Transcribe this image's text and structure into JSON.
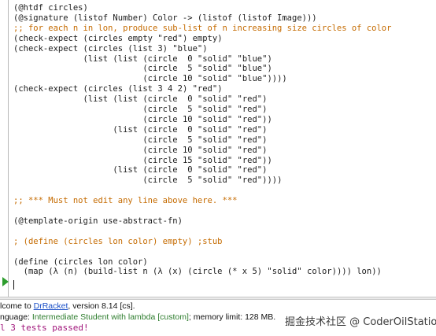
{
  "editor": {
    "lines": [
      [
        {
          "t": "(@htdf circles)",
          "k": "p"
        }
      ],
      [
        {
          "t": "(@signature (listof Number) Color -> (listof (listof Image)))",
          "k": "p"
        }
      ],
      [
        {
          "t": ";; for each n in lon, produce sub-list of n increasing size circles of color",
          "k": "c"
        }
      ],
      [
        {
          "t": "(check-expect (circles empty ",
          "k": "p"
        },
        {
          "t": "\"red\"",
          "k": "str"
        },
        {
          "t": ") empty)",
          "k": "p"
        }
      ],
      [
        {
          "t": "(check-expect (circles (list ",
          "k": "p"
        },
        {
          "t": "3",
          "k": "n"
        },
        {
          "t": ") ",
          "k": "p"
        },
        {
          "t": "\"blue\"",
          "k": "str"
        },
        {
          "t": ")",
          "k": "p"
        }
      ],
      [
        {
          "t": "              (list (list (circle  ",
          "k": "p"
        },
        {
          "t": "0",
          "k": "n"
        },
        {
          "t": " ",
          "k": "p"
        },
        {
          "t": "\"solid\"",
          "k": "str"
        },
        {
          "t": " ",
          "k": "p"
        },
        {
          "t": "\"blue\"",
          "k": "str"
        },
        {
          "t": ")",
          "k": "p"
        }
      ],
      [
        {
          "t": "                          (circle  ",
          "k": "p"
        },
        {
          "t": "5",
          "k": "n"
        },
        {
          "t": " ",
          "k": "p"
        },
        {
          "t": "\"solid\"",
          "k": "str"
        },
        {
          "t": " ",
          "k": "p"
        },
        {
          "t": "\"blue\"",
          "k": "str"
        },
        {
          "t": ")",
          "k": "p"
        }
      ],
      [
        {
          "t": "                          (circle ",
          "k": "p"
        },
        {
          "t": "10",
          "k": "n"
        },
        {
          "t": " ",
          "k": "p"
        },
        {
          "t": "\"solid\"",
          "k": "str"
        },
        {
          "t": " ",
          "k": "p"
        },
        {
          "t": "\"blue\"",
          "k": "str"
        },
        {
          "t": "))))",
          "k": "p"
        }
      ],
      [
        {
          "t": "(check-expect (circles (list ",
          "k": "p"
        },
        {
          "t": "3 4 2",
          "k": "n"
        },
        {
          "t": ") ",
          "k": "p"
        },
        {
          "t": "\"red\"",
          "k": "str"
        },
        {
          "t": ")",
          "k": "p"
        }
      ],
      [
        {
          "t": "              (list (list (circle  ",
          "k": "p"
        },
        {
          "t": "0",
          "k": "n"
        },
        {
          "t": " ",
          "k": "p"
        },
        {
          "t": "\"solid\"",
          "k": "str"
        },
        {
          "t": " ",
          "k": "p"
        },
        {
          "t": "\"red\"",
          "k": "str"
        },
        {
          "t": ")",
          "k": "p"
        }
      ],
      [
        {
          "t": "                          (circle  ",
          "k": "p"
        },
        {
          "t": "5",
          "k": "n"
        },
        {
          "t": " ",
          "k": "p"
        },
        {
          "t": "\"solid\"",
          "k": "str"
        },
        {
          "t": " ",
          "k": "p"
        },
        {
          "t": "\"red\"",
          "k": "str"
        },
        {
          "t": ")",
          "k": "p"
        }
      ],
      [
        {
          "t": "                          (circle ",
          "k": "p"
        },
        {
          "t": "10",
          "k": "n"
        },
        {
          "t": " ",
          "k": "p"
        },
        {
          "t": "\"solid\"",
          "k": "str"
        },
        {
          "t": " ",
          "k": "p"
        },
        {
          "t": "\"red\"",
          "k": "str"
        },
        {
          "t": "))",
          "k": "p"
        }
      ],
      [
        {
          "t": "                    (list (circle  ",
          "k": "p"
        },
        {
          "t": "0",
          "k": "n"
        },
        {
          "t": " ",
          "k": "p"
        },
        {
          "t": "\"solid\"",
          "k": "str"
        },
        {
          "t": " ",
          "k": "p"
        },
        {
          "t": "\"red\"",
          "k": "str"
        },
        {
          "t": ")",
          "k": "p"
        }
      ],
      [
        {
          "t": "                          (circle  ",
          "k": "p"
        },
        {
          "t": "5",
          "k": "n"
        },
        {
          "t": " ",
          "k": "p"
        },
        {
          "t": "\"solid\"",
          "k": "str"
        },
        {
          "t": " ",
          "k": "p"
        },
        {
          "t": "\"red\"",
          "k": "str"
        },
        {
          "t": ")",
          "k": "p"
        }
      ],
      [
        {
          "t": "                          (circle ",
          "k": "p"
        },
        {
          "t": "10",
          "k": "n"
        },
        {
          "t": " ",
          "k": "p"
        },
        {
          "t": "\"solid\"",
          "k": "str"
        },
        {
          "t": " ",
          "k": "p"
        },
        {
          "t": "\"red\"",
          "k": "str"
        },
        {
          "t": ")",
          "k": "p"
        }
      ],
      [
        {
          "t": "                          (circle ",
          "k": "p"
        },
        {
          "t": "15",
          "k": "n"
        },
        {
          "t": " ",
          "k": "p"
        },
        {
          "t": "\"solid\"",
          "k": "str"
        },
        {
          "t": " ",
          "k": "p"
        },
        {
          "t": "\"red\"",
          "k": "str"
        },
        {
          "t": "))",
          "k": "p"
        }
      ],
      [
        {
          "t": "                    (list (circle  ",
          "k": "p"
        },
        {
          "t": "0",
          "k": "n"
        },
        {
          "t": " ",
          "k": "p"
        },
        {
          "t": "\"solid\"",
          "k": "str"
        },
        {
          "t": " ",
          "k": "p"
        },
        {
          "t": "\"red\"",
          "k": "str"
        },
        {
          "t": ")",
          "k": "p"
        }
      ],
      [
        {
          "t": "                          (circle  ",
          "k": "p"
        },
        {
          "t": "5",
          "k": "n"
        },
        {
          "t": " ",
          "k": "p"
        },
        {
          "t": "\"solid\"",
          "k": "str"
        },
        {
          "t": " ",
          "k": "p"
        },
        {
          "t": "\"red\"",
          "k": "str"
        },
        {
          "t": "))))",
          "k": "p"
        }
      ],
      [],
      [
        {
          "t": ";; *** Must not edit any line above here. ***",
          "k": "c"
        }
      ],
      [],
      [
        {
          "t": "(@template-origin use-abstract-fn)",
          "k": "p"
        }
      ],
      [],
      [
        {
          "t": "; (define (circles lon color) empty) ;stub",
          "k": "c"
        }
      ],
      [],
      [
        {
          "t": "(define (circles lon color)",
          "k": "p"
        }
      ],
      [
        {
          "t": "  (map (λ (n) (build-list n (λ (x) (circle (* x ",
          "k": "p"
        },
        {
          "t": "5",
          "k": "n"
        },
        {
          "t": ") ",
          "k": "p"
        },
        {
          "t": "\"solid\"",
          "k": "str"
        },
        {
          "t": " color)))) lon))",
          "k": "p"
        }
      ]
    ]
  },
  "interactions": {
    "welcome_prefix": "lcome to ",
    "welcome_link": "DrRacket",
    "welcome_suffix": ", version 8.14 [cs].",
    "language_prefix": "nguage: ",
    "language_value": "Intermediate Student with lambda [custom]",
    "language_suffix": "; memory limit: 128 MB.",
    "tests_passed": "l 3 tests passed!"
  },
  "watermark": "掘金技术社区 @ CoderOilStation",
  "colors": {
    "comment": "#c56b00",
    "link": "#1a4fc7",
    "language": "#2e7d2e",
    "tests_passed": "#a0147a",
    "run_marker": "#2e9d2e"
  }
}
